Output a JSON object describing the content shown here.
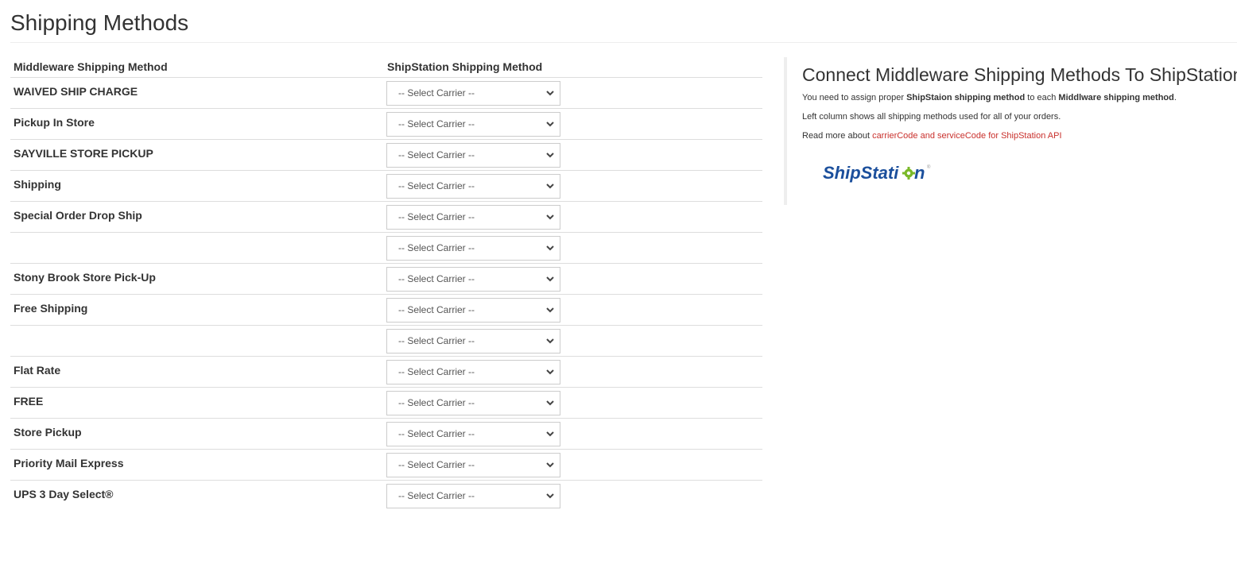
{
  "page": {
    "title": "Shipping Methods"
  },
  "table": {
    "headers": {
      "middleware": "Middleware Shipping Method",
      "shipstation": "ShipStation Shipping Method"
    },
    "rows": [
      {
        "method": "WAIVED SHIP CHARGE",
        "selected": "-- Select Carrier --"
      },
      {
        "method": "Pickup In Store",
        "selected": "-- Select Carrier --"
      },
      {
        "method": "SAYVILLE STORE PICKUP",
        "selected": "-- Select Carrier --"
      },
      {
        "method": "Shipping",
        "selected": "-- Select Carrier --"
      },
      {
        "method": "Special Order Drop Ship",
        "selected": "-- Select Carrier --"
      },
      {
        "method": "",
        "selected": "-- Select Carrier --"
      },
      {
        "method": "Stony Brook Store Pick-Up",
        "selected": "-- Select Carrier --"
      },
      {
        "method": "Free Shipping",
        "selected": "-- Select Carrier --"
      },
      {
        "method": "",
        "selected": "-- Select Carrier --"
      },
      {
        "method": "Flat Rate",
        "selected": "-- Select Carrier --"
      },
      {
        "method": "FREE",
        "selected": "-- Select Carrier --"
      },
      {
        "method": "Store Pickup",
        "selected": "-- Select Carrier --"
      },
      {
        "method": "Priority Mail Express",
        "selected": "-- Select Carrier --"
      },
      {
        "method": "UPS 3 Day Select®",
        "selected": "-- Select Carrier --"
      }
    ]
  },
  "side_panel": {
    "title": "Connect Middleware Shipping Methods To ShipStation",
    "p1_pre": "You need to assign proper ",
    "p1_bold1": "ShipStaion shipping method",
    "p1_mid": " to each ",
    "p1_bold2": "Middlware shipping method",
    "p1_post": ".",
    "p2": "Left column shows all shipping methods used for all of your orders.",
    "p3_pre": "Read more about ",
    "p3_link": "carrierCode and serviceCode for ShipStation API",
    "logo_text_a": "ShipStati",
    "logo_text_b": "n",
    "logo_reg": "®"
  },
  "colors": {
    "link": "#c9302c",
    "logo_blue": "#1b4f9c",
    "logo_green": "#7ab929"
  }
}
